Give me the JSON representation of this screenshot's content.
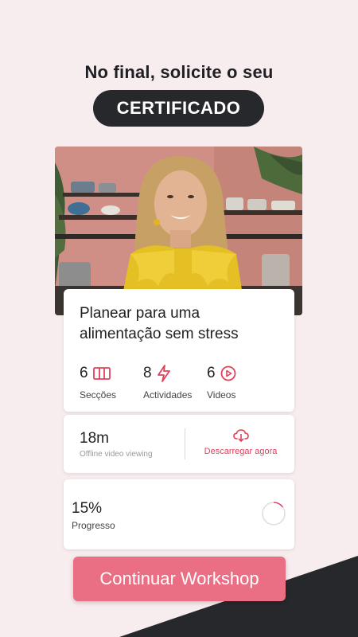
{
  "header": {
    "headline": "No final, solicite o seu",
    "badge": "CERTIFICADO"
  },
  "course": {
    "title": "Planear para uma alimentação sem stress",
    "stats": [
      {
        "value": "6",
        "label": "Secções",
        "icon": "columns-icon"
      },
      {
        "value": "8",
        "label": "Actividades",
        "icon": "lightning-icon"
      },
      {
        "value": "6",
        "label": "Videos",
        "icon": "play-circle-icon"
      }
    ]
  },
  "offline": {
    "duration": "18m",
    "caption": "Offline video viewing",
    "download_label": "Descarregar agora",
    "download_icon": "cloud-download-icon"
  },
  "progress": {
    "value": "15%",
    "label": "Progresso",
    "fraction": 0.15
  },
  "cta": {
    "label": "Continuar Workshop"
  },
  "colors": {
    "background": "#f7ecee",
    "accent": "#ea6f84",
    "accent_text": "#e0405c",
    "dark": "#26282c"
  }
}
